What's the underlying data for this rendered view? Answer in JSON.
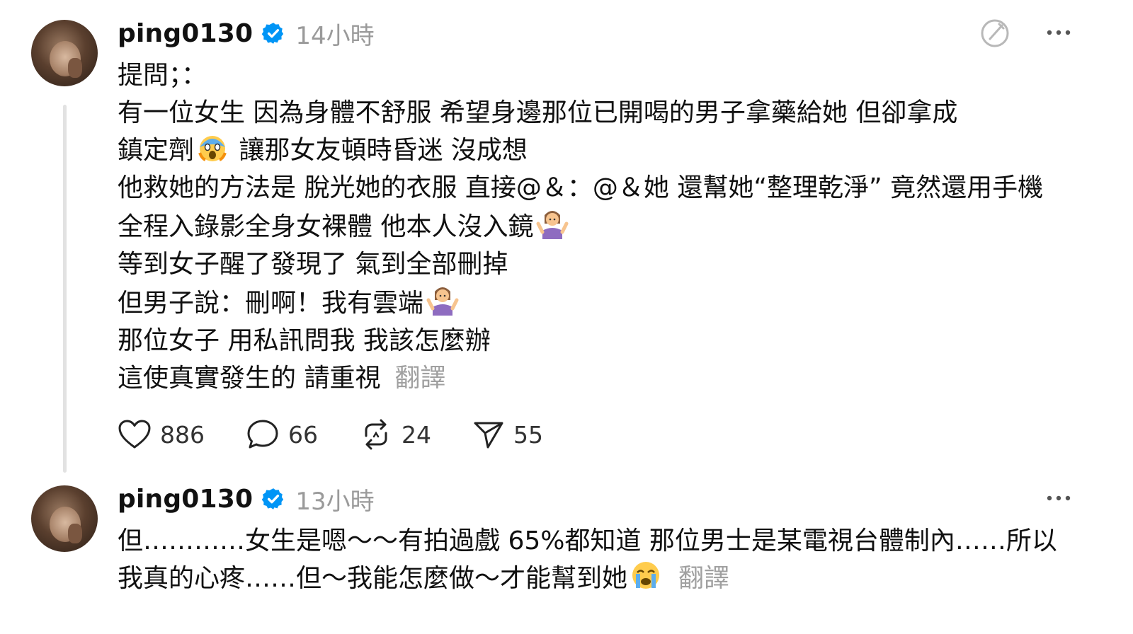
{
  "post1": {
    "username": "ping0130",
    "time": "14小時",
    "lines": [
      "提問；：",
      "有一位女生 因為身體不舒服 希望身邊那位已開喝的男子拿藥給她 但卻拿成",
      "鎮定劑",
      " 讓那女友頓時昏迷 沒成想",
      "他救她的方法是 脫光她的衣服 直接@＆：@＆她 還幫她“整理乾淨” 竟然還用手機",
      "全程入錄影全身女裸體 他本人沒入鏡",
      "等到女子醒了發現了 氣到全部刪掉",
      "但男子說：刪啊！我有雲端",
      "那位女子 用私訊問我 我該怎麼辦",
      "這使真實發生的 請重視"
    ],
    "translate": "翻譯",
    "likes": "886",
    "comments": "66",
    "reposts": "24",
    "shares": "55"
  },
  "post2": {
    "username": "ping0130",
    "time": "13小時",
    "lines": [
      "但…………女生是嗯～～有拍過戲 65%都知道 那位男士是某電視台體制內……所以",
      "我真的心疼……但～我能怎麼做～才能幫到她"
    ],
    "translate": "翻譯"
  },
  "icons": {
    "verified": "verified-badge-icon",
    "more": "more-options-icon",
    "compose": "compose-icon",
    "like": "heart-icon",
    "comment": "comment-icon",
    "repost": "repost-icon",
    "share": "share-icon",
    "emoji_scream": "scream-face-emoji",
    "emoji_shrug": "shrugging-woman-emoji",
    "emoji_cry": "crying-face-emoji"
  },
  "colors": {
    "verified": "#0095f6",
    "muted": "#9a9a9a",
    "line": "#e2e2e2"
  }
}
